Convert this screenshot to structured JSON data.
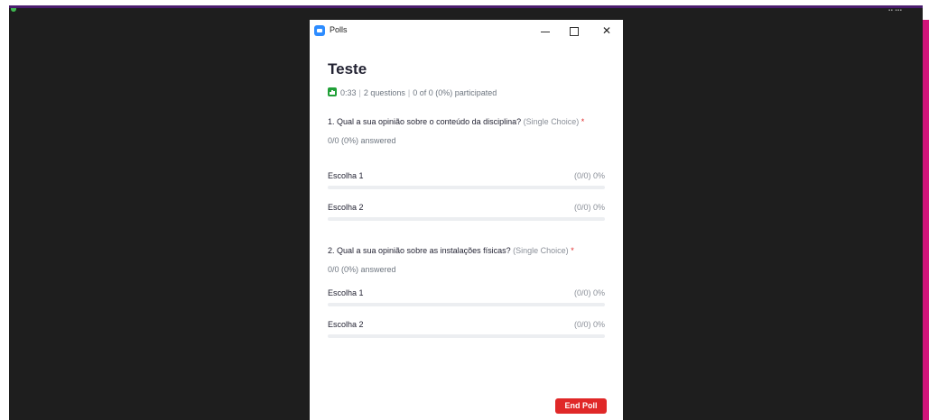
{
  "window": {
    "title": "Polls",
    "app_icon": "zoom-camera-icon"
  },
  "poll": {
    "title": "Teste",
    "meta": {
      "duration": "0:33",
      "questions": "2 questions",
      "participation": "0 of 0 (0%) participated"
    },
    "questions": [
      {
        "text": "1. Qual a sua opinião sobre o conteúdo da disciplina?",
        "type": "(Single Choice)",
        "required_mark": "*",
        "answered": "0/0 (0%) answered",
        "choices": [
          {
            "label": "Escolha 1",
            "value": "(0/0) 0%",
            "fraction": 0
          },
          {
            "label": "Escolha 2",
            "value": "(0/0) 0%",
            "fraction": 0
          }
        ]
      },
      {
        "text": "2. Qual a sua opinião sobre as instalações físicas?",
        "type": "(Single Choice)",
        "required_mark": "*",
        "answered": "0/0 (0%) answered",
        "choices": [
          {
            "label": "Escolha 1",
            "value": "(0/0) 0%",
            "fraction": 0
          },
          {
            "label": "Escolha 2",
            "value": "(0/0) 0%",
            "fraction": 0
          }
        ]
      }
    ],
    "end_button": "End Poll"
  },
  "colors": {
    "accent": "#2d8cff",
    "end_button": "#e02828",
    "meta_icon": "#21a038"
  }
}
